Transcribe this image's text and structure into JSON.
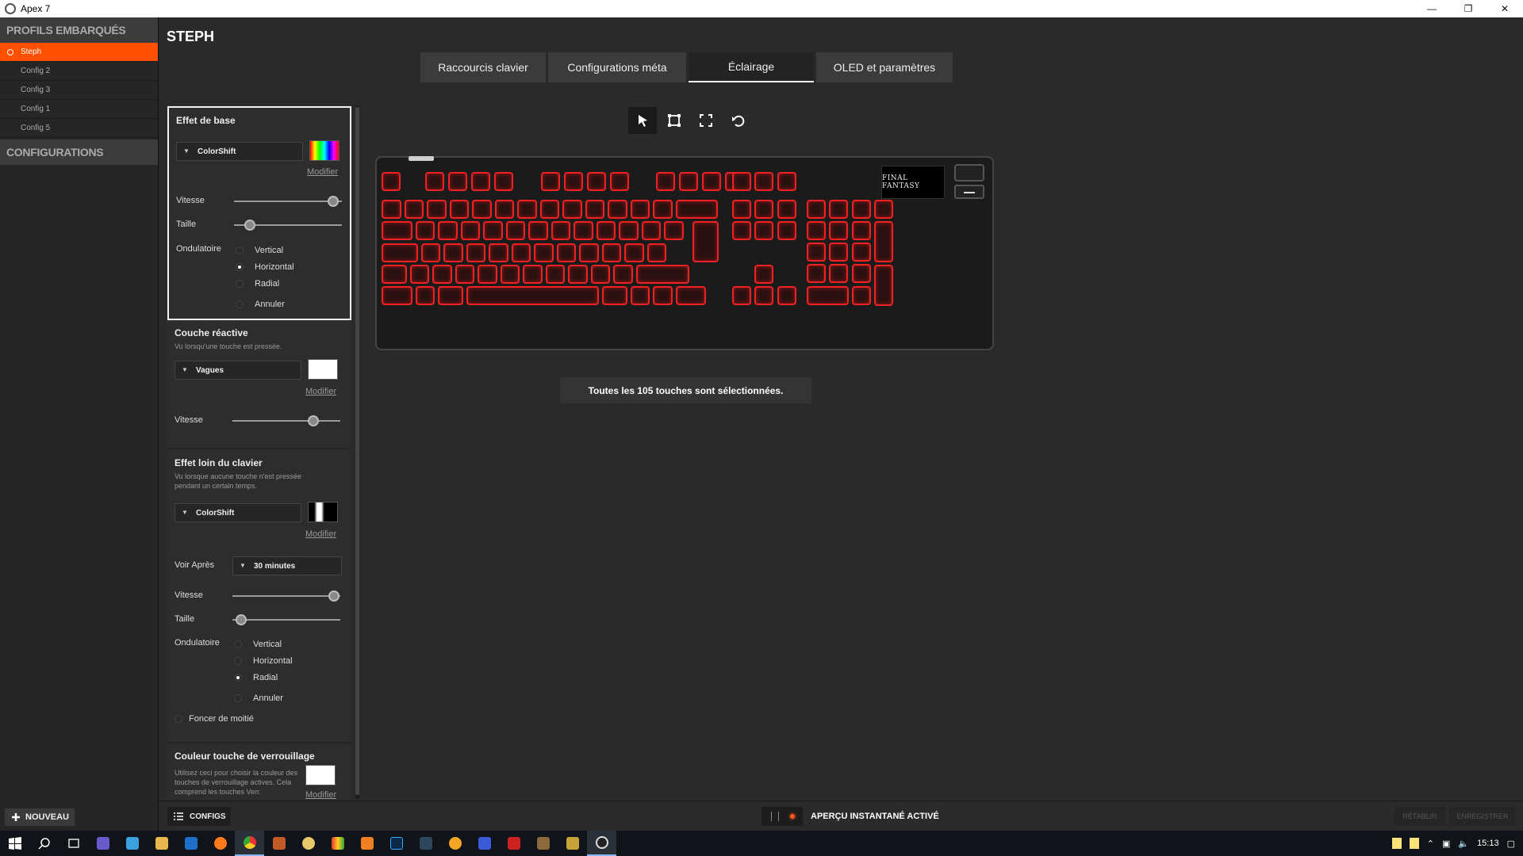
{
  "window": {
    "title": "Apex 7"
  },
  "sidebar": {
    "profiles_header": "PROFILS EMBARQUÉS",
    "profiles": [
      "Steph",
      "Config 2",
      "Config 3",
      "Config 1",
      "Config 5"
    ],
    "active_profile": "Steph",
    "configs_header": "CONFIGURATIONS",
    "new_button": "NOUVEAU"
  },
  "main": {
    "title": "STEPH",
    "tabs": [
      "Raccourcis clavier",
      "Configurations méta",
      "Éclairage",
      "OLED et paramètres"
    ],
    "active_tab": "Éclairage",
    "selection_status": "Toutes les 105 touches sont sélectionnées.",
    "keyboard_logo": "FINAL FANTASY"
  },
  "panel": {
    "modifier_label": "Modifier",
    "base_effect": {
      "title": "Effet de base",
      "effect": "ColorShift",
      "speed_label": "Vitesse",
      "speed_value": 0.92,
      "size_label": "Taille",
      "size_value": 0.15,
      "wave_label": "Ondulatoire",
      "wave_options": [
        "Vertical",
        "Horizontal",
        "Radial",
        "Annuler"
      ],
      "wave_selected": "Horizontal"
    },
    "reactive": {
      "title": "Couche réactive",
      "desc": "Vu lorsqu'une touche est pressée.",
      "effect": "Vagues",
      "speed_label": "Vitesse",
      "speed_value": 0.75
    },
    "idle": {
      "title": "Effet loin du clavier",
      "desc": "Vu lorsque aucune touche n'est pressée pendant un certain temps.",
      "effect": "ColorShift",
      "after_label": "Voir Après",
      "after_value": "30 minutes",
      "speed_label": "Vitesse",
      "speed_value": 0.94,
      "size_label": "Taille",
      "size_value": 0.08,
      "wave_label": "Ondulatoire",
      "wave_options": [
        "Vertical",
        "Horizontal",
        "Radial",
        "Annuler"
      ],
      "wave_selected": "Radial",
      "dim_label": "Foncer de moitié"
    },
    "lock": {
      "title": "Couleur touche de verrouillage",
      "desc": "Utilisez ceci pour choisir la couleur des touches de verrouillage actives. Cela comprend les touches Verr."
    }
  },
  "bottom": {
    "configs_button": "CONFIGS",
    "preview_label": "APERÇU INSTANTANÉ ACTIVÉ",
    "reset_button": "RÉTABLIR",
    "save_button": "ENREGISTRER"
  },
  "taskbar": {
    "time": "15:13"
  }
}
